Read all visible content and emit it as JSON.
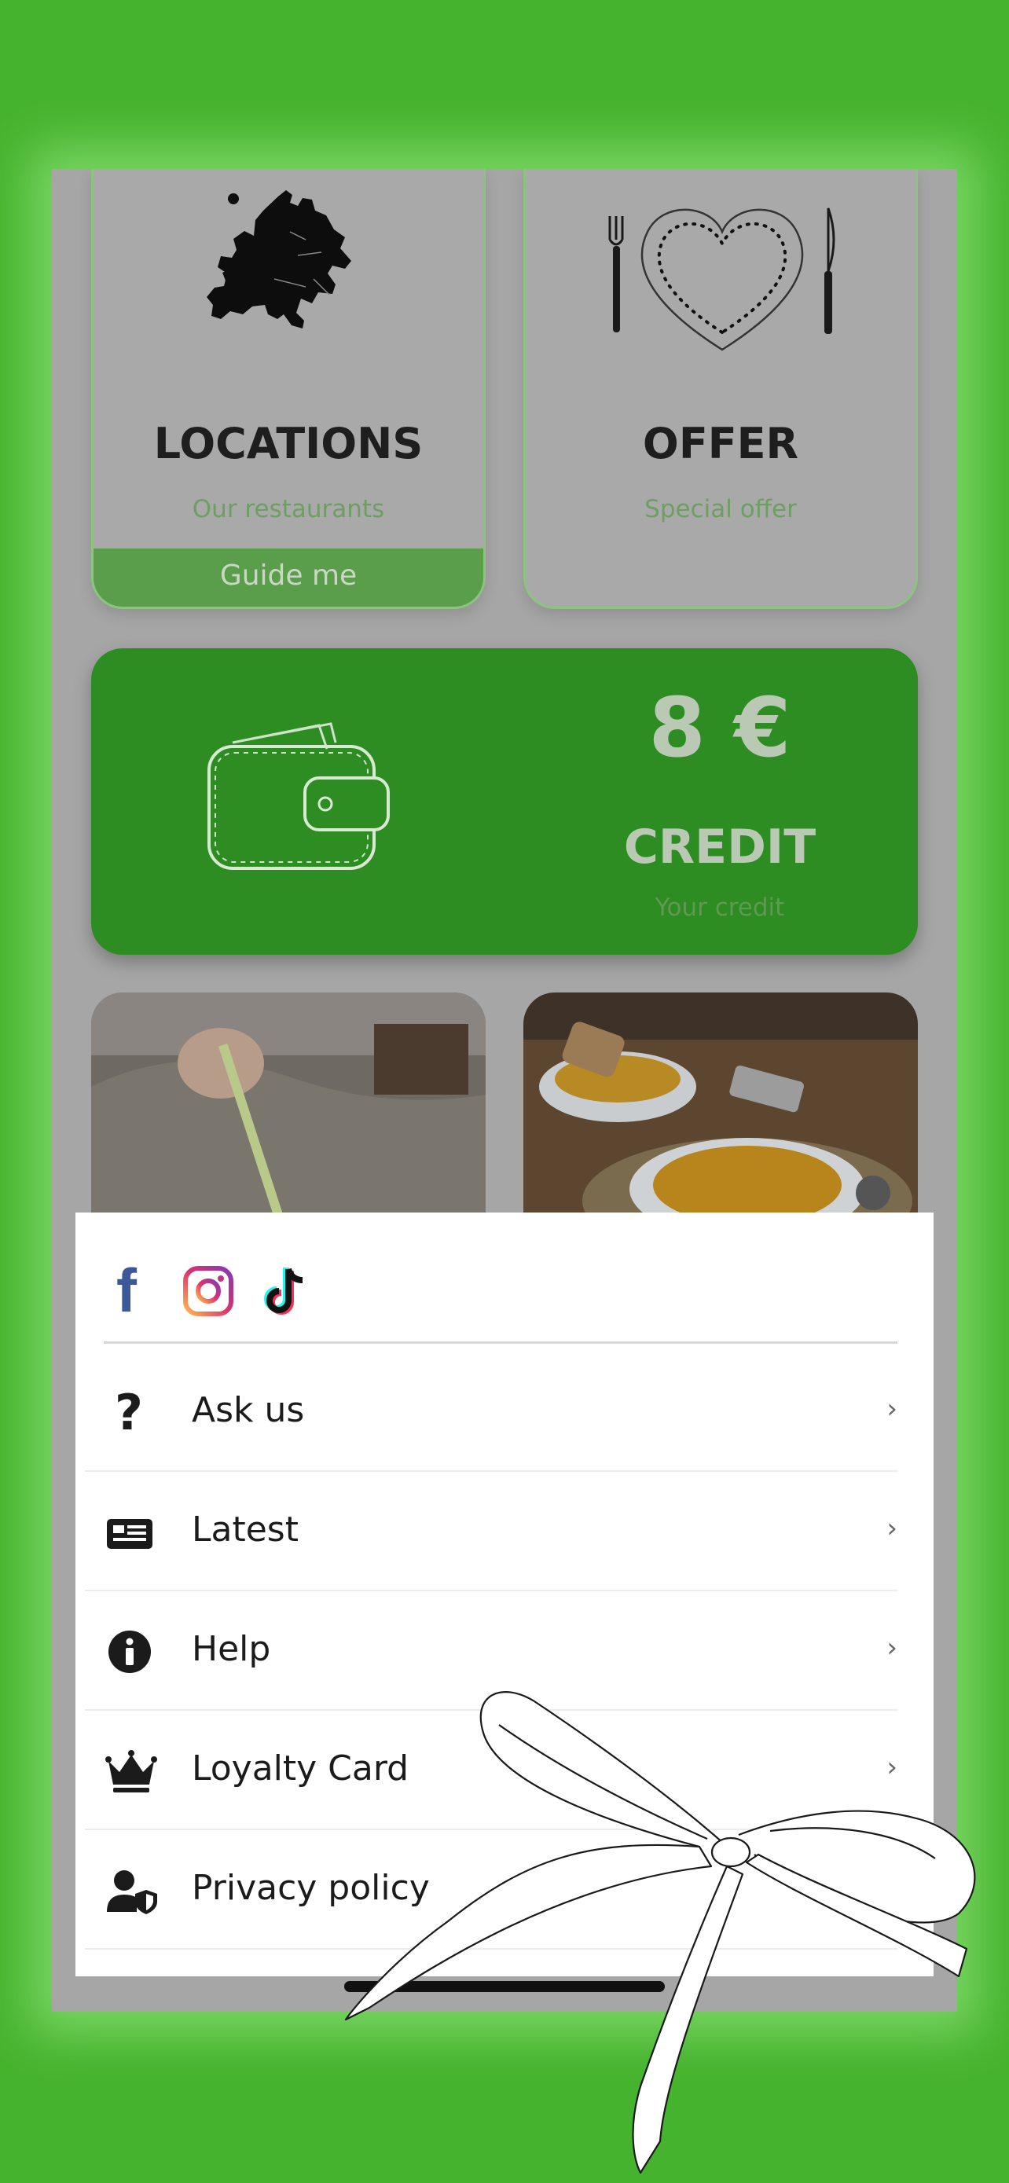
{
  "cards": {
    "locations": {
      "title": "LOCATIONS",
      "subtitle": "Our restaurants",
      "button_label": "Guide me",
      "icon": "europe-map-icon"
    },
    "offer": {
      "title": "OFFER",
      "subtitle": "Special offer",
      "icon": "heart-plate-cutlery-icon"
    }
  },
  "credit": {
    "amount": "8 €",
    "title": "CREDIT",
    "subtitle": "Your credit",
    "icon": "wallet-icon"
  },
  "social": [
    {
      "name": "facebook-icon",
      "glyph": "f",
      "color": "#3b5998"
    },
    {
      "name": "instagram-icon",
      "color": "#e1306c"
    },
    {
      "name": "tiktok-icon",
      "glyph": "♪",
      "color": "#000000"
    }
  ],
  "menu": {
    "items": [
      {
        "label": "Ask us",
        "icon": "question-icon",
        "chevron": "›"
      },
      {
        "label": "Latest",
        "icon": "news-icon",
        "chevron": "›"
      },
      {
        "label": "Help",
        "icon": "info-icon",
        "chevron": "›"
      },
      {
        "label": "Loyalty Card",
        "icon": "crown-icon",
        "chevron": "›"
      },
      {
        "label": "Privacy policy",
        "icon": "user-shield-icon",
        "chevron": "›"
      }
    ]
  },
  "colors": {
    "background": "#46b32e",
    "credit_card": "#2d8c22",
    "accent_text": "#6e9f62"
  }
}
